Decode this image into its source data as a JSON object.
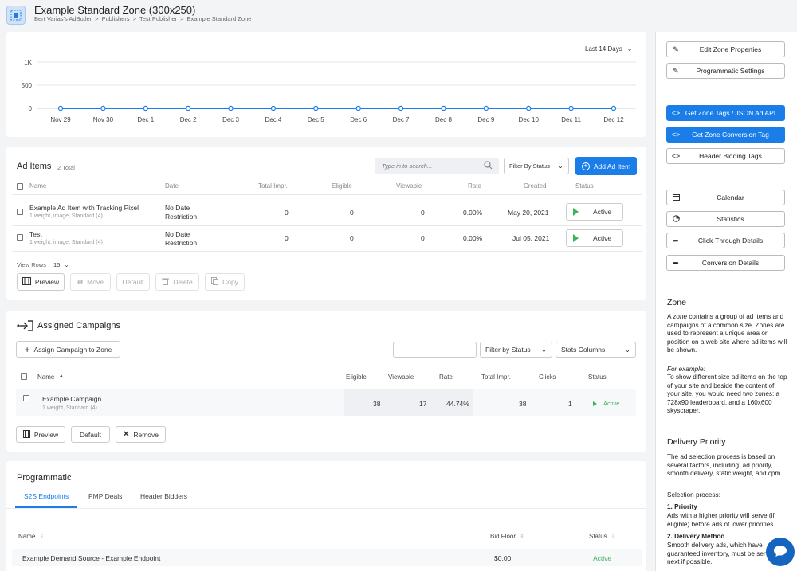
{
  "header": {
    "title": "Example Standard Zone (300x250)",
    "breadcrumb": [
      "Bert Varias's AdButler",
      ">",
      "Publishers",
      ">",
      "Test Publisher",
      ">",
      "Example Standard Zone"
    ]
  },
  "chart": {
    "range_label": "Last 14 Days"
  },
  "chart_data": {
    "type": "line",
    "categories": [
      "Nov 29",
      "Nov 30",
      "Dec 1",
      "Dec 2",
      "Dec 3",
      "Dec 4",
      "Dec 5",
      "Dec 6",
      "Dec 7",
      "Dec 8",
      "Dec 9",
      "Dec 10",
      "Dec 11",
      "Dec 12"
    ],
    "values": [
      0,
      0,
      0,
      0,
      0,
      0,
      0,
      0,
      0,
      0,
      0,
      0,
      0,
      0
    ],
    "yticks": [
      "1K",
      "500",
      "0"
    ],
    "ylim": [
      0,
      1000
    ],
    "grid": true,
    "color": "#1a7de8"
  },
  "ad_items": {
    "title": "Ad Items",
    "total": "2 Total",
    "search_placeholder": "Type in to search...",
    "filter_label": "Filter By Status",
    "add_label": "Add Ad Item",
    "columns": [
      "Name",
      "Date",
      "Total Impr.",
      "Eligible",
      "Viewable",
      "Rate",
      "Created",
      "Status"
    ],
    "rows": [
      {
        "name": "Example Ad Item with Tracking Pixel",
        "sub": "1 weight, image, Standard (4)",
        "date1": "No Date",
        "date2": "Restriction",
        "impr": "0",
        "eligible": "0",
        "viewable": "0",
        "rate": "0.00%",
        "created": "May 20, 2021",
        "status": "Active"
      },
      {
        "name": "Test",
        "sub": "1 weight, image, Standard (4)",
        "date1": "No Date",
        "date2": "Restriction",
        "impr": "0",
        "eligible": "0",
        "viewable": "0",
        "rate": "0.00%",
        "created": "Jul 05, 2021",
        "status": "Active"
      }
    ],
    "view_rows_label": "View Rows",
    "view_rows_value": "15",
    "actions": {
      "preview": "Preview",
      "move": "Move",
      "default": "Default",
      "delete": "Delete",
      "copy": "Copy"
    }
  },
  "campaigns": {
    "title": "Assigned Campaigns",
    "assign_label": "Assign Campaign to Zone",
    "search_value": "",
    "filter_label": "Filter by Status",
    "columns_label": "Stats Columns",
    "columns": [
      "Name",
      "Eligible",
      "Viewable",
      "Rate",
      "Total Impr.",
      "Clicks",
      "Status"
    ],
    "rows": [
      {
        "name": "Example Campaign",
        "sub": "1 weight, Standard (4)",
        "eligible": "38",
        "viewable": "17",
        "rate": "44.74%",
        "impr": "38",
        "clicks": "1",
        "status": "Active"
      }
    ],
    "actions": {
      "preview": "Preview",
      "default": "Default",
      "remove": "Remove"
    }
  },
  "programmatic": {
    "title": "Programmatic",
    "tabs": [
      "S2S Endpoints",
      "PMP Deals",
      "Header Bidders"
    ],
    "columns": [
      "Name",
      "Bid Floor",
      "Status"
    ],
    "rows": [
      {
        "name": "Example Demand Source - Example Endpoint",
        "bid_floor": "$0.00",
        "status": "Active"
      }
    ]
  },
  "sidebar": {
    "buttons": {
      "edit": "Edit Zone Properties",
      "prog_settings": "Programmatic Settings",
      "tags": "Get Zone Tags / JSON Ad API",
      "conv_tag": "Get Zone Conversion Tag",
      "hb_tags": "Header Bidding Tags",
      "calendar": "Calendar",
      "statistics": "Statistics",
      "ct_details": "Click-Through Details",
      "conv_details": "Conversion Details"
    },
    "zone_heading": "Zone",
    "zone_p1_pre": "A ",
    "zone_p1_em": "zone",
    "zone_p1_post": " contains a group of ad items and campaigns of a common size. Zones are used to represent a unique area or position on a web site where ad items will be shown.",
    "example_label": "For example:",
    "example_text": "To show different size ad items on the top of your site and beside the content of your site, you would need two zones: a 728x90 leaderboard, and a 160x600 skyscraper.",
    "priority_heading": "Delivery Priority",
    "priority_p": "The ad selection process is based on several factors, including: ad priority, smooth delivery, static weight, and cpm.",
    "selection_label": "Selection process:",
    "step1_title": "1. Priority",
    "step1_text": "Ads with a higher priority will serve (if eligible) before ads of lower priorities.",
    "step2_title": "2. Delivery Method",
    "step2_text": "Smooth delivery ads, which have guaranteed inventory, must be served next if possible."
  },
  "colors": {
    "accent": "#1a7de8",
    "active": "#3cb55a"
  }
}
